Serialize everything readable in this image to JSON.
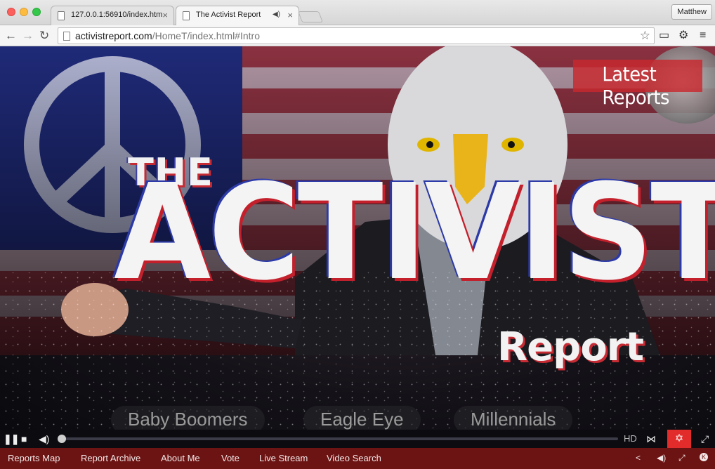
{
  "browser": {
    "tabs": [
      {
        "title": "127.0.0.1:56910/index.htm"
      },
      {
        "title": "The Activist Report"
      }
    ],
    "profile_name": "Matthew",
    "url_host": "activistreport.com",
    "url_path": "/HomeT/index.html#Intro"
  },
  "hero": {
    "latest_reports_label": "Latest Reports",
    "logo": {
      "the": "THE",
      "activist": "ACTIVIST",
      "report": "Report"
    },
    "categories": [
      "Baby Boomers",
      "Eagle Eye",
      "Millennials"
    ]
  },
  "video_controls": {
    "hd_label": "HD",
    "progress": 0.0
  },
  "bottom_nav": {
    "items": [
      "Reports Map",
      "Report Archive",
      "About Me",
      "Vote",
      "Live Stream",
      "Video Search"
    ]
  },
  "colors": {
    "accent_red": "#c8282d",
    "nav_bar": "#6b1413",
    "control_bar": "#0b0b10"
  }
}
